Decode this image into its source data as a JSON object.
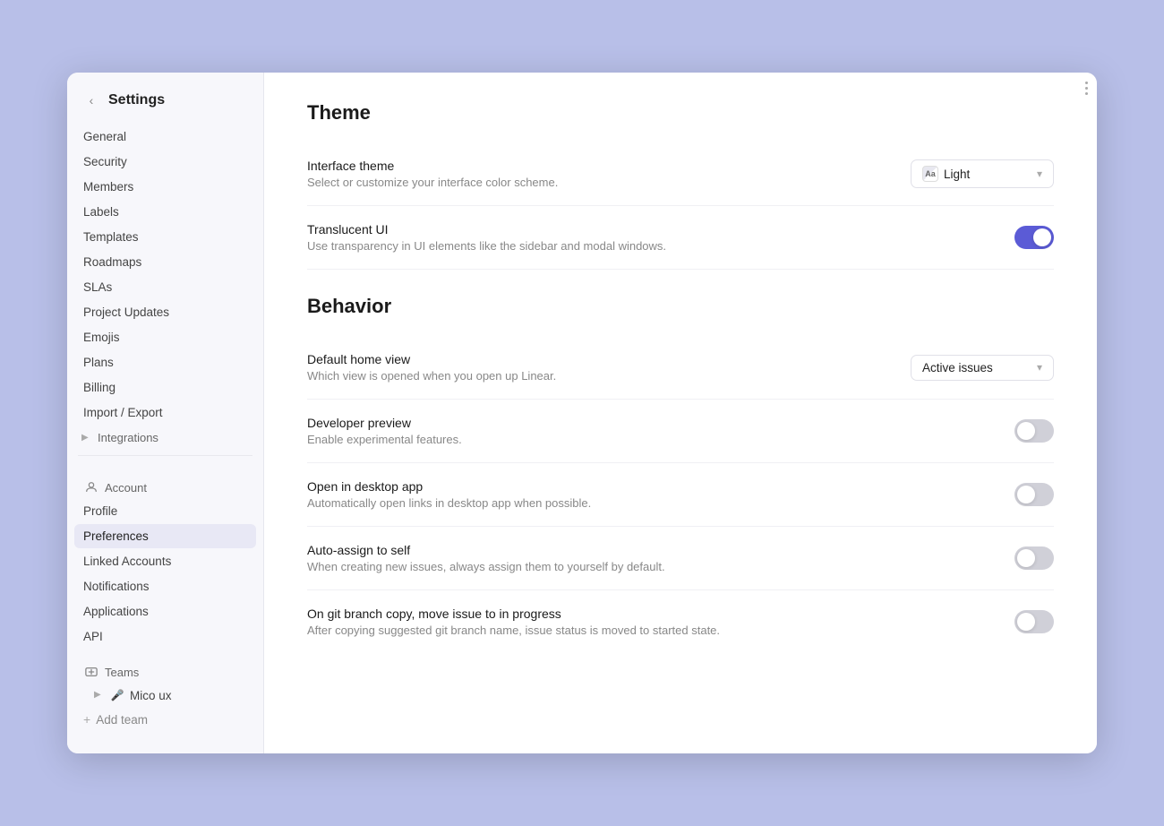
{
  "window": {
    "title": "Settings"
  },
  "sidebar": {
    "back_label": "‹",
    "title": "Settings",
    "workspace_items": [
      {
        "id": "general",
        "label": "General"
      },
      {
        "id": "security",
        "label": "Security"
      },
      {
        "id": "members",
        "label": "Members"
      },
      {
        "id": "labels",
        "label": "Labels"
      },
      {
        "id": "templates",
        "label": "Templates"
      },
      {
        "id": "roadmaps",
        "label": "Roadmaps"
      },
      {
        "id": "slas",
        "label": "SLAs"
      },
      {
        "id": "project-updates",
        "label": "Project Updates"
      },
      {
        "id": "emojis",
        "label": "Emojis"
      },
      {
        "id": "plans",
        "label": "Plans"
      },
      {
        "id": "billing",
        "label": "Billing"
      },
      {
        "id": "import-export",
        "label": "Import / Export"
      }
    ],
    "integrations_label": "Integrations",
    "account_label": "Account",
    "account_items": [
      {
        "id": "profile",
        "label": "Profile"
      },
      {
        "id": "preferences",
        "label": "Preferences",
        "active": true
      },
      {
        "id": "linked-accounts",
        "label": "Linked Accounts"
      },
      {
        "id": "notifications",
        "label": "Notifications"
      },
      {
        "id": "applications",
        "label": "Applications"
      },
      {
        "id": "api",
        "label": "API"
      }
    ],
    "teams_label": "Teams",
    "team_name": "Mico ux",
    "add_team_label": "Add team"
  },
  "main": {
    "theme_section_title": "Theme",
    "interface_theme_label": "Interface theme",
    "interface_theme_desc": "Select or customize your interface color scheme.",
    "theme_value": "Light",
    "theme_dot_text": "Aa",
    "translucent_label": "Translucent UI",
    "translucent_desc": "Use transparency in UI elements like the sidebar and modal windows.",
    "translucent_on": true,
    "behavior_section_title": "Behavior",
    "default_home_label": "Default home view",
    "default_home_desc": "Which view is opened when you open up Linear.",
    "default_home_value": "Active issues",
    "developer_preview_label": "Developer preview",
    "developer_preview_desc": "Enable experimental features.",
    "developer_preview_on": false,
    "open_desktop_label": "Open in desktop app",
    "open_desktop_desc": "Automatically open links in desktop app when possible.",
    "open_desktop_on": false,
    "auto_assign_label": "Auto-assign to self",
    "auto_assign_desc": "When creating new issues, always assign them to yourself by default.",
    "auto_assign_on": false,
    "git_branch_label": "On git branch copy, move issue to in progress",
    "git_branch_desc": "After copying suggested git branch name, issue status is moved to started state.",
    "git_branch_on": false
  }
}
